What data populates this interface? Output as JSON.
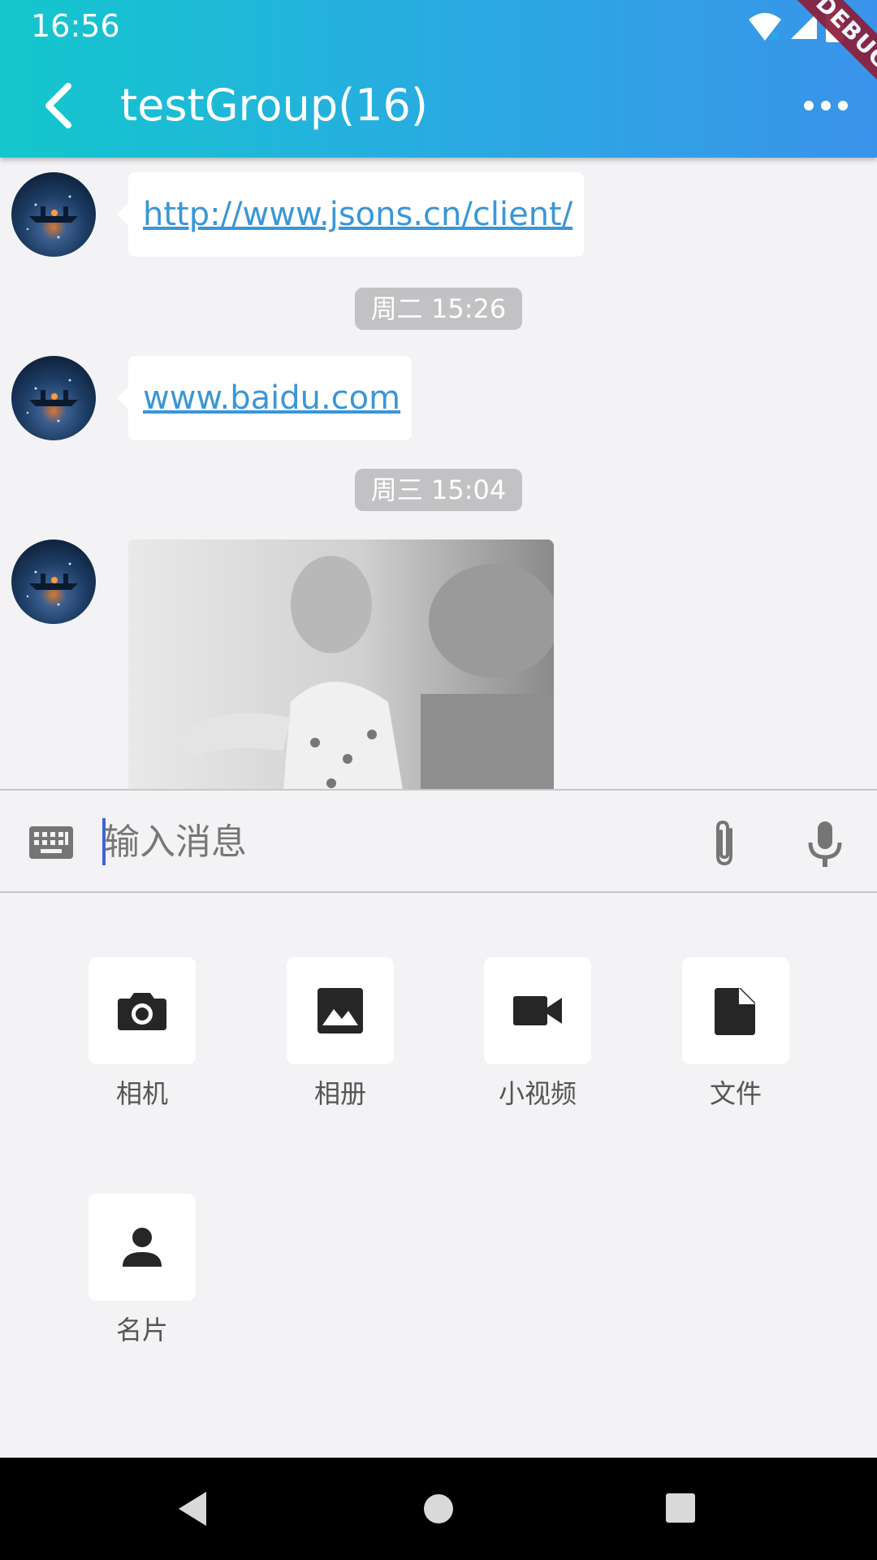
{
  "status_bar": {
    "time": "16:56",
    "icons": [
      "wifi-icon",
      "signal-icon",
      "battery-icon"
    ]
  },
  "debug_banner": "DEBUG",
  "header": {
    "back_icon": "chevron-left-icon",
    "title": "testGroup(16)",
    "more_icon": "more-horizontal-icon"
  },
  "messages": [
    {
      "type": "link",
      "text": "http://www.jsons.cn/client/"
    },
    {
      "type": "time",
      "text": "周二 15:26"
    },
    {
      "type": "link",
      "text": "www.baidu.com"
    },
    {
      "type": "time",
      "text": "周三 15:04"
    },
    {
      "type": "image",
      "description": "grayscale photo"
    }
  ],
  "input": {
    "keyboard_icon": "keyboard-icon",
    "placeholder": "输入消息",
    "value": "",
    "attach_icon": "paperclip-icon",
    "mic_icon": "microphone-icon"
  },
  "actions": [
    {
      "label": "相机",
      "icon": "camera-icon"
    },
    {
      "label": "相册",
      "icon": "image-icon"
    },
    {
      "label": "小视频",
      "icon": "videocam-icon"
    },
    {
      "label": "文件",
      "icon": "file-icon"
    },
    {
      "label": "名片",
      "icon": "person-icon"
    }
  ],
  "nav_bar": {
    "icons": [
      "back-triangle-icon",
      "home-circle-icon",
      "recents-square-icon"
    ]
  },
  "colors": {
    "header_start": "#13c7cc",
    "header_end": "#3a93ea",
    "link": "#3b96d6",
    "caret": "#3f63dd",
    "time_chip": "#c2c2c4"
  }
}
